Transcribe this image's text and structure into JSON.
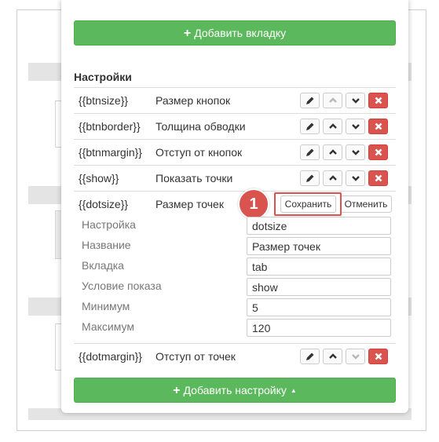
{
  "top_button": {
    "icon": "plus-icon",
    "label": "Добавить вкладку"
  },
  "section_title": "Настройки",
  "rows": [
    {
      "var": "{{btnsize}}",
      "label": "Размер кнопок"
    },
    {
      "var": "{{btnborder}}",
      "label": "Толщина обводки"
    },
    {
      "var": "{{btnmargin}}",
      "label": "Отступ от кнопок"
    },
    {
      "var": "{{show}}",
      "label": "Показать точки"
    }
  ],
  "editing_row": {
    "var": "{{dotsize}}",
    "label": "Размер точек",
    "save_label": "Сохранить",
    "cancel_label": "Отменить",
    "badge": "1",
    "fields": [
      {
        "label": "Настройка",
        "value": "dotsize"
      },
      {
        "label": "Название",
        "value": "Размер точек"
      },
      {
        "label": "Вкладка",
        "value": "tab"
      },
      {
        "label": "Условие показа",
        "value": "show"
      },
      {
        "label": "Минимум",
        "value": "5"
      },
      {
        "label": "Максимум",
        "value": "120"
      }
    ]
  },
  "last_row": {
    "var": "{{dotmargin}}",
    "label": "Отступ от точек"
  },
  "bottom_button": {
    "icon": "plus-icon",
    "label": "Добавить настройку",
    "caret": "caret-up-icon"
  },
  "colors": {
    "green": "#5cb85c",
    "red": "#d9534f",
    "border": "#dddddd",
    "muted": "#777777"
  }
}
